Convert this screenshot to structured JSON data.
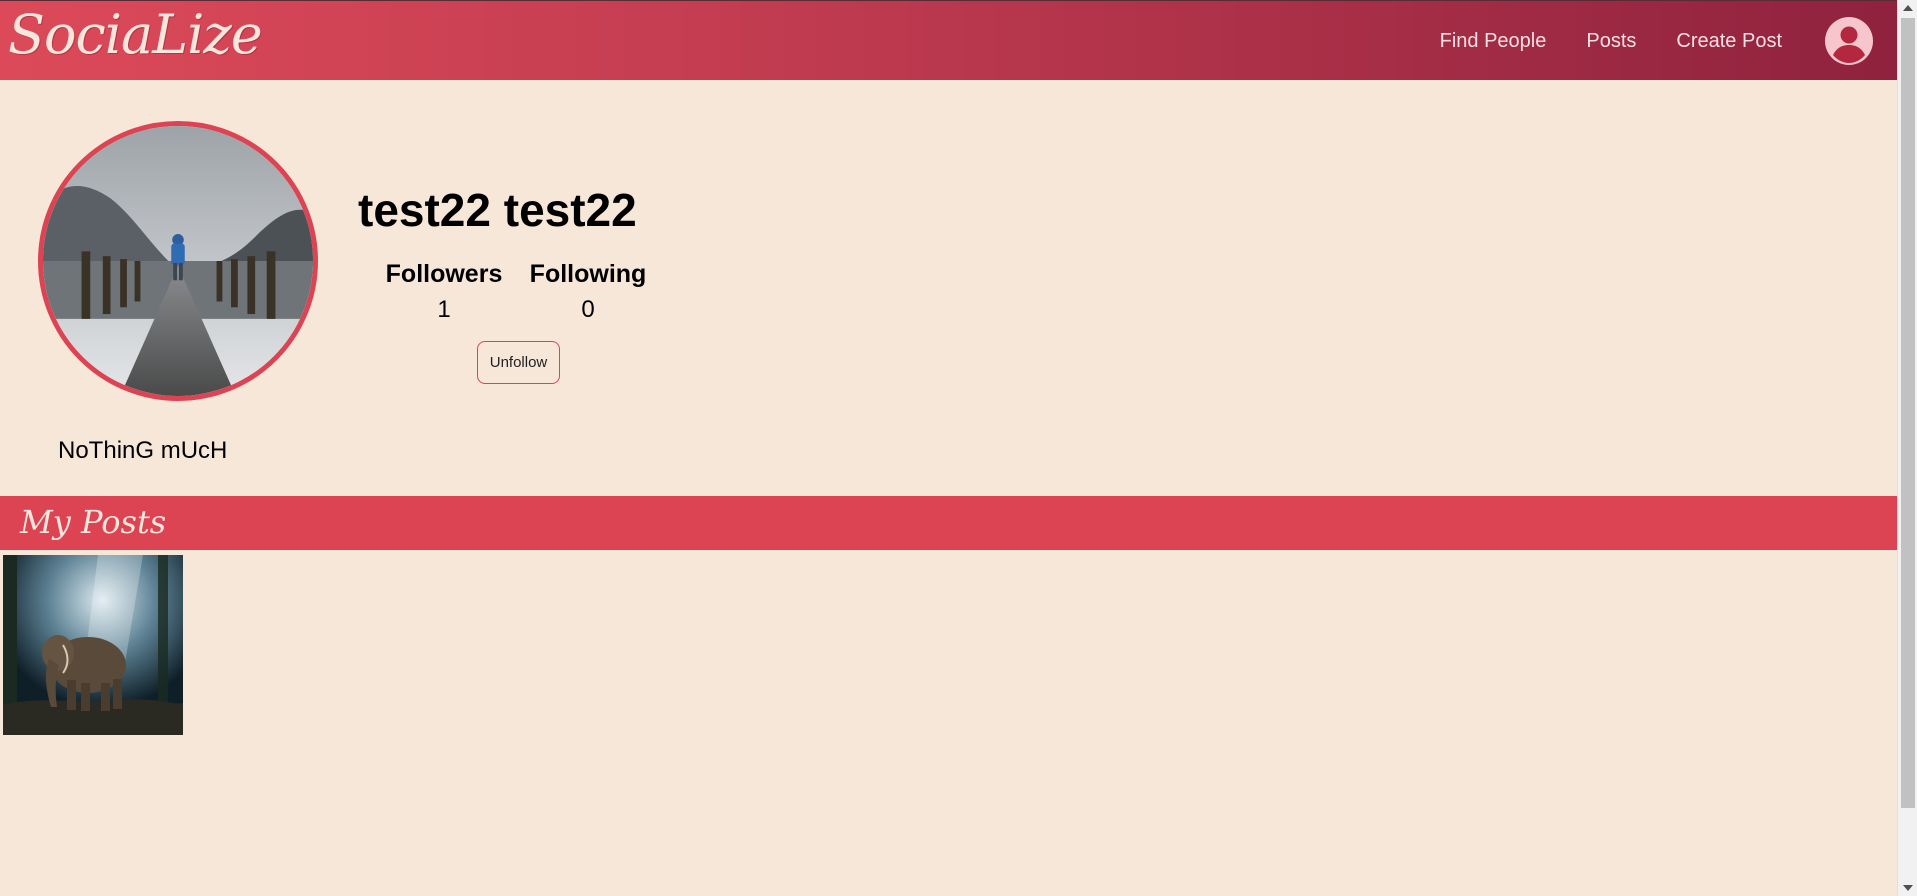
{
  "navbar": {
    "brand": "SociaLize",
    "links": [
      "Find People",
      "Posts",
      "Create Post"
    ],
    "account_icon": "account-circle-icon"
  },
  "profile": {
    "name": "test22 test22",
    "followers_label": "Followers",
    "followers_count": "1",
    "following_label": "Following",
    "following_count": "0",
    "unfollow_label": "Unfollow",
    "bio": "NoThinG mUcH"
  },
  "posts": {
    "title": "My Posts"
  },
  "colors": {
    "accent": "#dc4353",
    "background": "#f7e7d8",
    "nav_gradient_start": "#dc4a59",
    "nav_gradient_end": "#8f223e"
  }
}
